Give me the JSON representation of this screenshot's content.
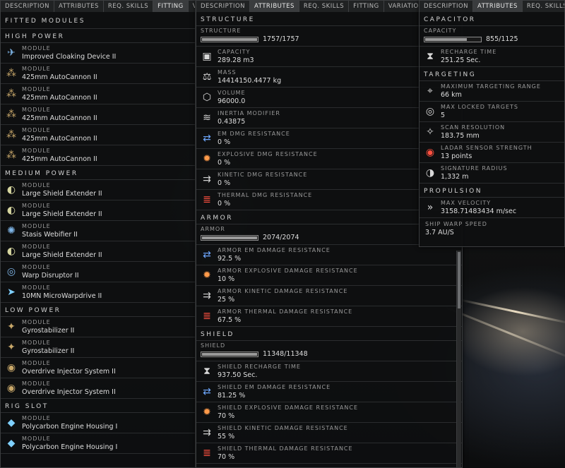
{
  "left": {
    "tabs": [
      "Description",
      "Attributes",
      "Req. Skills",
      "Fitting",
      "Varia"
    ],
    "active_tab": 3,
    "title": "Fitted Modules",
    "groups": [
      {
        "name": "High Power",
        "items": [
          {
            "label": "Module",
            "value": "Improved Cloaking Device II",
            "icon": "cloak-icon"
          },
          {
            "label": "Module",
            "value": "425mm AutoCannon II",
            "icon": "autocannon-icon"
          },
          {
            "label": "Module",
            "value": "425mm AutoCannon II",
            "icon": "autocannon-icon"
          },
          {
            "label": "Module",
            "value": "425mm AutoCannon II",
            "icon": "autocannon-icon"
          },
          {
            "label": "Module",
            "value": "425mm AutoCannon II",
            "icon": "autocannon-icon"
          },
          {
            "label": "Module",
            "value": "425mm AutoCannon II",
            "icon": "autocannon-icon"
          }
        ]
      },
      {
        "name": "Medium Power",
        "items": [
          {
            "label": "Module",
            "value": "Large Shield Extender II",
            "icon": "shield-extender-icon"
          },
          {
            "label": "Module",
            "value": "Large Shield Extender II",
            "icon": "shield-extender-icon"
          },
          {
            "label": "Module",
            "value": "Stasis Webifier II",
            "icon": "webifier-icon"
          },
          {
            "label": "Module",
            "value": "Large Shield Extender II",
            "icon": "shield-extender-icon"
          },
          {
            "label": "Module",
            "value": "Warp Disruptor II",
            "icon": "warp-disruptor-icon"
          },
          {
            "label": "Module",
            "value": "10MN MicroWarpdrive II",
            "icon": "microwarpdrive-icon"
          }
        ]
      },
      {
        "name": "Low Power",
        "items": [
          {
            "label": "Module",
            "value": "Gyrostabilizer II",
            "icon": "gyrostabilizer-icon"
          },
          {
            "label": "Module",
            "value": "Gyrostabilizer II",
            "icon": "gyrostabilizer-icon"
          },
          {
            "label": "Module",
            "value": "Overdrive Injector System II",
            "icon": "overdrive-icon"
          },
          {
            "label": "Module",
            "value": "Overdrive Injector System II",
            "icon": "overdrive-icon"
          }
        ]
      },
      {
        "name": "Rig Slot",
        "items": [
          {
            "label": "Module",
            "value": "Polycarbon Engine Housing I",
            "icon": "rig-icon"
          },
          {
            "label": "Module",
            "value": "Polycarbon Engine Housing I",
            "icon": "rig-icon"
          }
        ]
      }
    ]
  },
  "middle": {
    "tabs": [
      "Description",
      "Attributes",
      "Req. Skills",
      "Fitting",
      "Variations"
    ],
    "active_tab": 1,
    "structure": {
      "title": "Structure",
      "bar": {
        "label": "Structure",
        "value": "1757/1757",
        "fraction": 1.0
      },
      "rows": [
        {
          "label": "Capacity",
          "value": "289.28 m3",
          "icon": "capacity-icon"
        },
        {
          "label": "Mass",
          "value": "14414150.4477 kg",
          "icon": "mass-icon"
        },
        {
          "label": "Volume",
          "value": "96000.0",
          "icon": "volume-icon"
        },
        {
          "label": "Inertia Modifier",
          "value": "0.43875",
          "icon": "inertia-icon"
        },
        {
          "label": "EM dmg resistance",
          "value": "0 %",
          "icon": "em-resist-icon"
        },
        {
          "label": "Explosive dmg resistance",
          "value": "0 %",
          "icon": "explosive-resist-icon"
        },
        {
          "label": "Kinetic dmg resistance",
          "value": "0 %",
          "icon": "kinetic-resist-icon"
        },
        {
          "label": "Thermal dmg resistance",
          "value": "0 %",
          "icon": "thermal-resist-icon"
        }
      ]
    },
    "armor": {
      "title": "Armor",
      "bar": {
        "label": "Armor",
        "value": "2074/2074",
        "fraction": 1.0
      },
      "rows": [
        {
          "label": "Armor EM Damage Resistance",
          "value": "92.5 %",
          "icon": "em-resist-icon"
        },
        {
          "label": "Armor Explosive Damage Resistance",
          "value": "10 %",
          "icon": "explosive-resist-icon"
        },
        {
          "label": "Armor Kinetic Damage Resistance",
          "value": "25 %",
          "icon": "kinetic-resist-icon"
        },
        {
          "label": "Armor Thermal Damage Resistance",
          "value": "67.5 %",
          "icon": "thermal-resist-icon"
        }
      ]
    },
    "shield": {
      "title": "Shield",
      "bar": {
        "label": "Shield",
        "value": "11348/11348",
        "fraction": 1.0
      },
      "rows": [
        {
          "label": "Shield recharge time",
          "value": "937.50 Sec.",
          "icon": "hourglass-icon"
        },
        {
          "label": "Shield EM Damage Resistance",
          "value": "81.25 %",
          "icon": "em-resist-icon"
        },
        {
          "label": "Shield Explosive Damage Resistance",
          "value": "70 %",
          "icon": "explosive-resist-icon"
        },
        {
          "label": "Shield Kinetic Damage Resistance",
          "value": "55 %",
          "icon": "kinetic-resist-icon"
        },
        {
          "label": "Shield Thermal Damage Resistance",
          "value": "70 %",
          "icon": "thermal-resist-icon"
        }
      ]
    }
  },
  "right": {
    "tabs": [
      "Description",
      "Attributes",
      "Req. Skills"
    ],
    "active_tab": 1,
    "capacitor": {
      "title": "Capacitor",
      "bar": {
        "label": "Capacity",
        "value": "855/1125",
        "fraction": 0.76
      },
      "rows": [
        {
          "label": "Recharge time",
          "value": "251.25 Sec.",
          "icon": "hourglass-icon"
        }
      ]
    },
    "targeting": {
      "title": "Targeting",
      "rows": [
        {
          "label": "Maximum Targeting Range",
          "value": "66 km",
          "icon": "targeting-range-icon"
        },
        {
          "label": "Max Locked Targets",
          "value": "5",
          "icon": "locked-targets-icon"
        },
        {
          "label": "Scan Resolution",
          "value": "183.75 mm",
          "icon": "scan-resolution-icon"
        },
        {
          "label": "Ladar Sensor Strength",
          "value": "13 points",
          "icon": "ladar-sensor-icon"
        },
        {
          "label": "Signature Radius",
          "value": "1,332 m",
          "icon": "signature-radius-icon"
        }
      ]
    },
    "propulsion": {
      "title": "Propulsion",
      "rows": [
        {
          "label": "Max Velocity",
          "value": "3158.71483434 m/sec",
          "icon": "velocity-icon"
        }
      ],
      "warp": {
        "label": "Ship Warp Speed",
        "value": "3.7 AU/S"
      }
    }
  }
}
